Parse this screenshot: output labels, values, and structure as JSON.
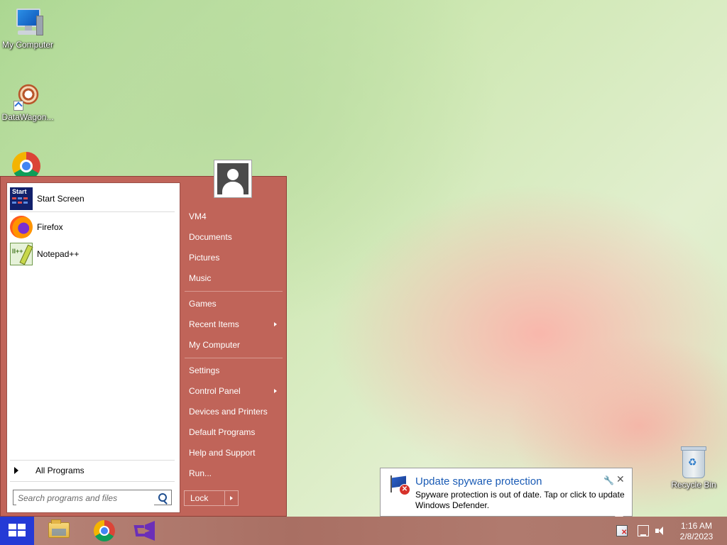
{
  "desktop": {
    "icons": [
      {
        "label": "My Computer"
      },
      {
        "label": "DataWagon..."
      },
      {
        "label": "Google Chrome"
      }
    ],
    "recycle_bin": "Recycle Bin"
  },
  "start_menu": {
    "pinned": [
      {
        "label": "Start Screen",
        "icon": "start-screen-icon",
        "icon_text": "Start"
      },
      {
        "label": "Firefox",
        "icon": "firefox-icon"
      },
      {
        "label": "Notepad++",
        "icon": "notepadpp-icon"
      }
    ],
    "all_programs": "All Programs",
    "search_placeholder": "Search programs and files",
    "right_items": [
      {
        "label": "VM4"
      },
      {
        "label": "Documents"
      },
      {
        "label": "Pictures"
      },
      {
        "label": "Music"
      },
      {
        "label": "Games"
      },
      {
        "label": "Recent Items",
        "submenu": true
      },
      {
        "label": "My Computer"
      },
      {
        "label": "Settings"
      },
      {
        "label": "Control Panel",
        "submenu": true
      },
      {
        "label": "Devices and Printers"
      },
      {
        "label": "Default Programs"
      },
      {
        "label": "Help and Support"
      },
      {
        "label": "Run..."
      }
    ],
    "lock_label": "Lock",
    "accent_color": "#c06459"
  },
  "notification": {
    "title": "Update spyware protection",
    "message": "Spyware protection is out of date. Tap or click to update Windows Defender."
  },
  "taskbar": {
    "apps": [
      "file-explorer-icon",
      "chrome-icon",
      "visual-studio-icon"
    ],
    "time": "1:16 AM",
    "date": "2/8/2023",
    "start_color": "#243ad6"
  }
}
